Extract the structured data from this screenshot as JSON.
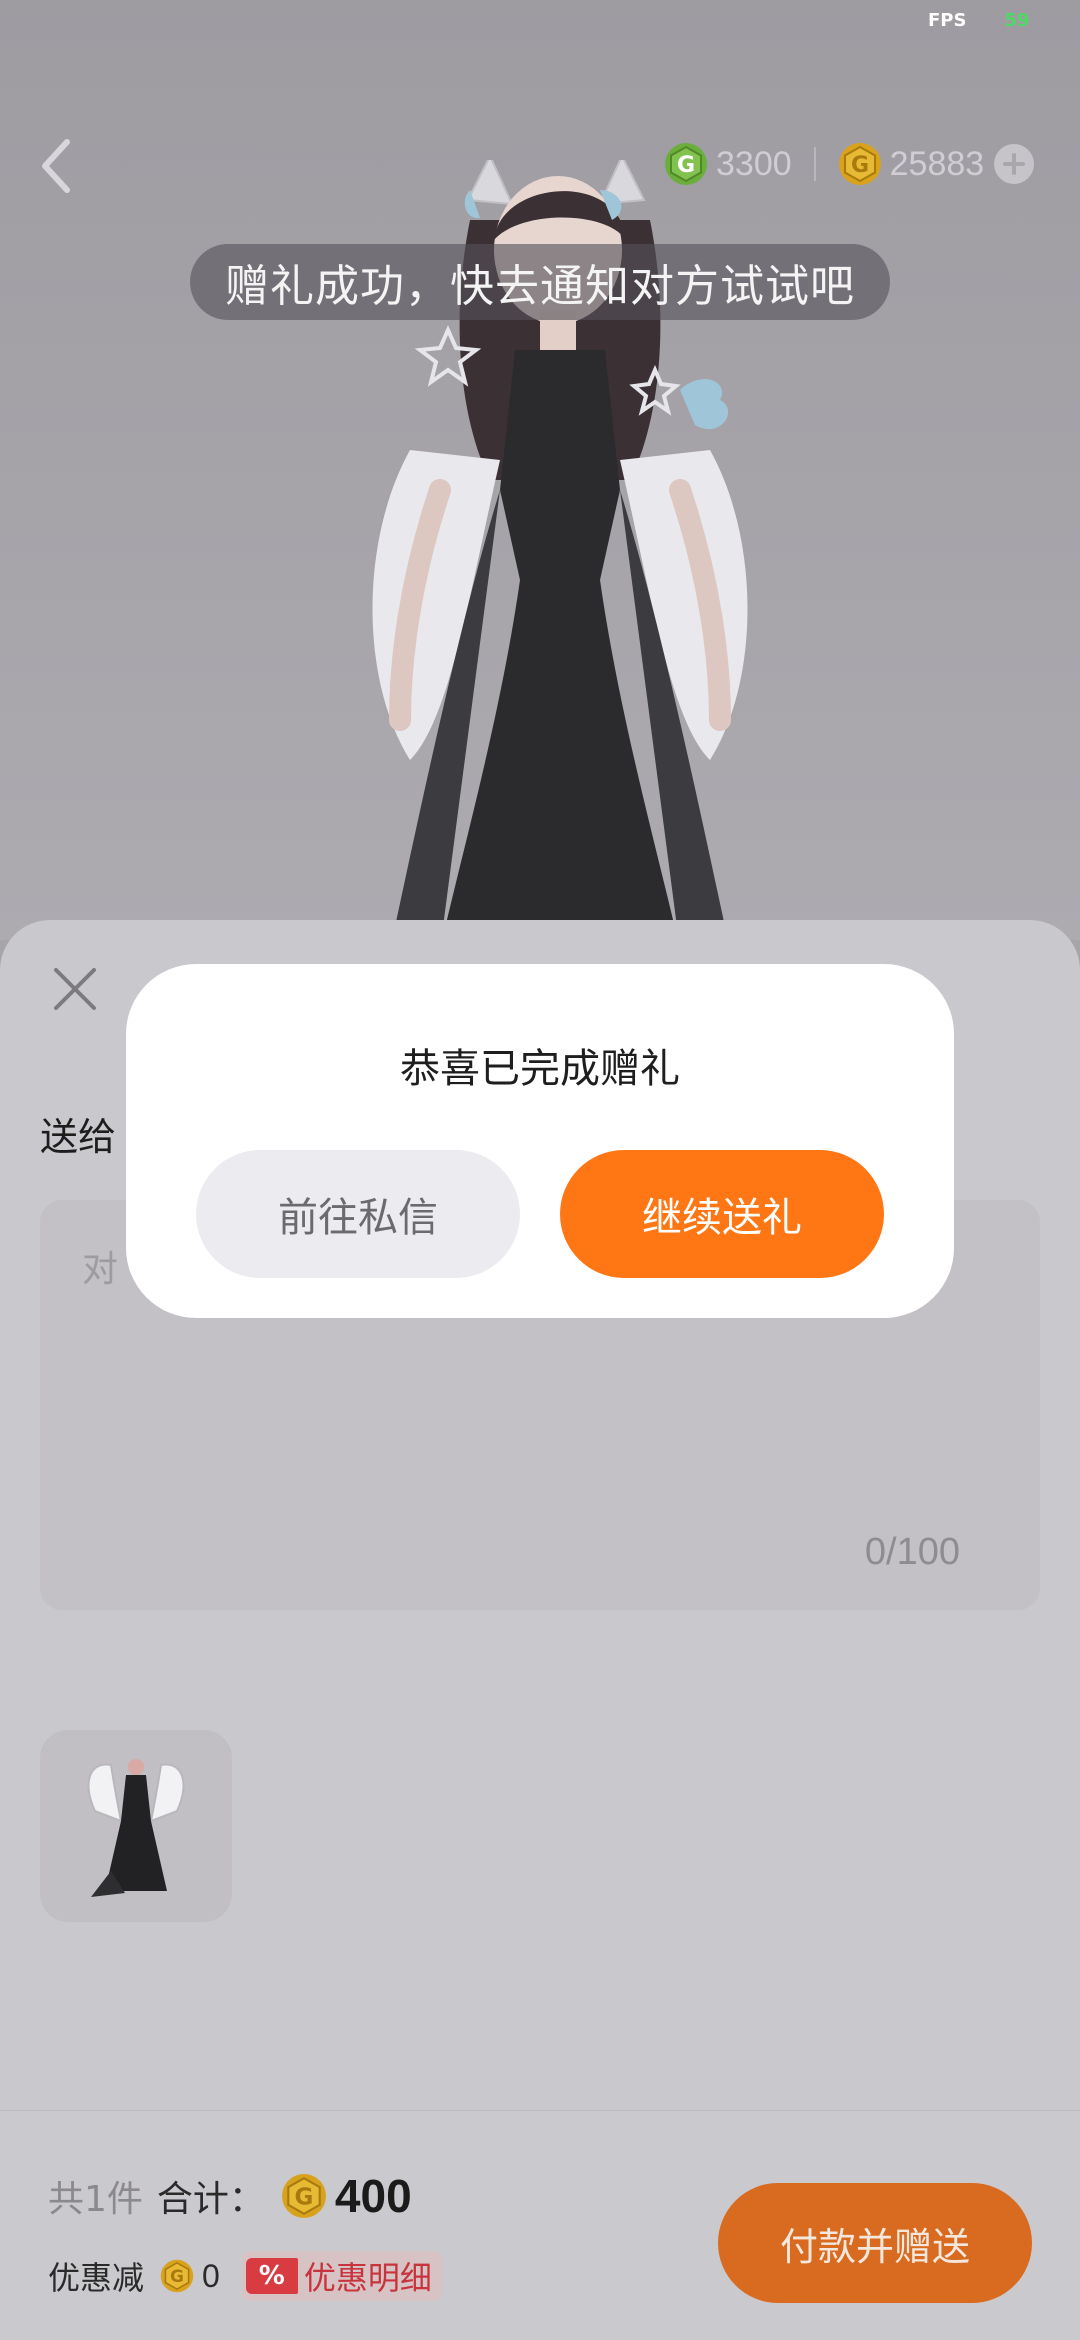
{
  "status": {
    "fps_label": "FPS",
    "fps_value": "59"
  },
  "header": {
    "green_coin_amount": "3300",
    "gold_coin_amount": "25883"
  },
  "toast": {
    "text": "赠礼成功，快去通知对方试试吧"
  },
  "sheet": {
    "send_to_label": "送给",
    "message_placeholder": "对",
    "char_count": "0/100"
  },
  "footer": {
    "item_count": "共1件",
    "total_label": "合计：",
    "total_amount": "400",
    "discount_label": "优惠减",
    "discount_amount": "0",
    "discount_badge": "%",
    "discount_detail_label": "优惠明细",
    "pay_button_label": "付款并赠送"
  },
  "dialog": {
    "title": "恭喜已完成赠礼",
    "secondary_button": "前往私信",
    "primary_button": "继续送礼"
  },
  "colors": {
    "accent_orange": "#ff7714",
    "green_coin": "#6cae3c",
    "gold_coin": "#d9a21c",
    "discount_red": "#d93b43"
  }
}
